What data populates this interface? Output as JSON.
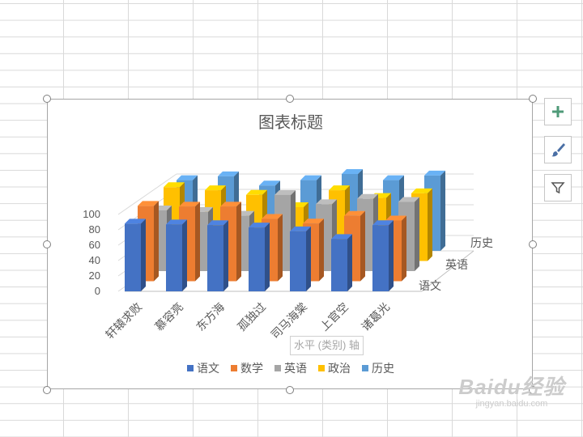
{
  "chart_data": {
    "type": "bar3d",
    "title": "图表标题",
    "categories": [
      "轩辕求败",
      "慕容亮",
      "东方海",
      "孤独过",
      "司马海棠",
      "上官空",
      "诸葛光"
    ],
    "depth_labels": [
      "语文",
      "英语",
      "历史"
    ],
    "y_ticks": [
      "0",
      "20",
      "40",
      "60",
      "80",
      "100"
    ],
    "ylim": [
      0,
      100
    ],
    "legend_position": "bottom",
    "series": [
      {
        "name": "语文",
        "color": "#4472C4",
        "values": [
          88,
          87,
          86,
          83,
          78,
          68,
          86
        ]
      },
      {
        "name": "数学",
        "color": "#ED7D31",
        "values": [
          98,
          97,
          97,
          81,
          75,
          85,
          79
        ]
      },
      {
        "name": "英语",
        "color": "#A5A5A5",
        "values": [
          79,
          77,
          72,
          99,
          87,
          94,
          90
        ]
      },
      {
        "name": "政治",
        "color": "#FFC000",
        "values": [
          96,
          92,
          86,
          70,
          92,
          82,
          88
        ]
      },
      {
        "name": "历史",
        "color": "#5B9BD5",
        "values": [
          92,
          97,
          85,
          92,
          100,
          92,
          98
        ]
      }
    ]
  },
  "axis_tooltip": "水平 (类别) 轴",
  "side_buttons": [
    {
      "icon": "plus-icon"
    },
    {
      "icon": "brush-icon"
    },
    {
      "icon": "filter-icon"
    }
  ],
  "watermark": {
    "logo": "Baidu经验",
    "url": "jingyan.baidu.com"
  }
}
